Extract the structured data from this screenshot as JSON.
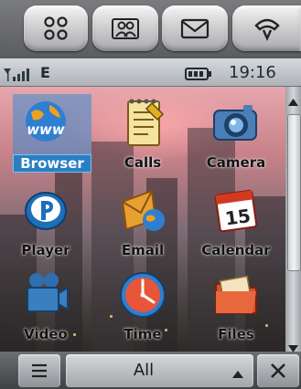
{
  "top_buttons": [
    {
      "icon": "app-grid-icon"
    },
    {
      "icon": "contacts-icon"
    },
    {
      "icon": "messages-icon"
    },
    {
      "icon": "phone-icon"
    }
  ],
  "status": {
    "network": "E",
    "time": "19:16",
    "signal_icon": "signal-bars-icon",
    "battery_icon": "battery-icon"
  },
  "apps": [
    {
      "label": "Browser",
      "icon": "globe-www-icon",
      "selected": true
    },
    {
      "label": "Calls",
      "icon": "notepad-calls-icon",
      "selected": false
    },
    {
      "label": "Camera",
      "icon": "camera-icon",
      "selected": false
    },
    {
      "label": "Player",
      "icon": "media-player-icon",
      "selected": false
    },
    {
      "label": "Email",
      "icon": "email-icon",
      "selected": false
    },
    {
      "label": "Calendar",
      "icon": "calendar-icon",
      "selected": false
    },
    {
      "label": "Video",
      "icon": "video-camera-icon",
      "selected": false
    },
    {
      "label": "Time",
      "icon": "clock-icon",
      "selected": false
    },
    {
      "label": "Files",
      "icon": "folder-icon",
      "selected": false
    }
  ],
  "calendar_day": "15",
  "bottom": {
    "center_label": "All",
    "left_icon": "menu-icon",
    "right_icon": "close-icon"
  },
  "colors": {
    "selection": "#2a7fc4",
    "statusbar": "#c5c9cd"
  }
}
